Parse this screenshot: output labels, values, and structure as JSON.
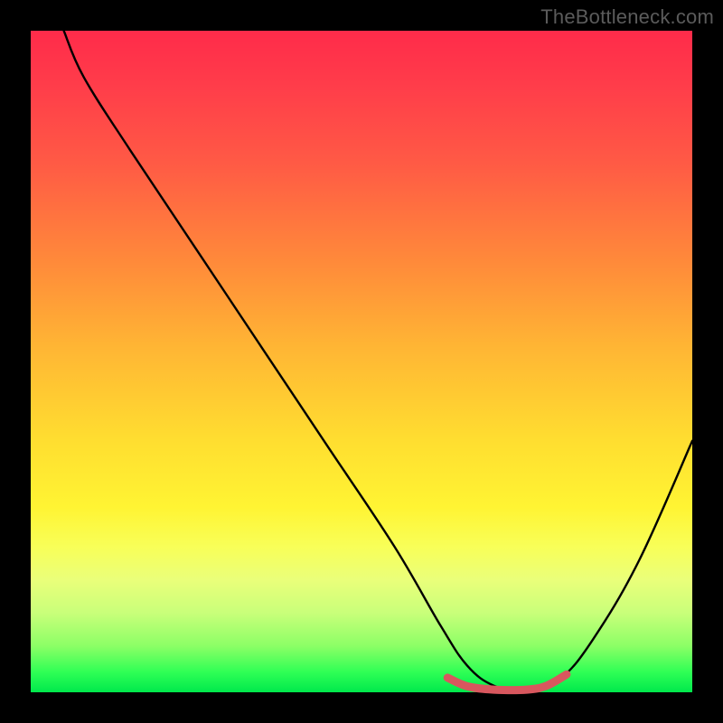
{
  "watermark": "TheBottleneck.com",
  "chart_data": {
    "type": "line",
    "title": "",
    "xlabel": "",
    "ylabel": "",
    "xlim": [
      0,
      100
    ],
    "ylim": [
      0,
      100
    ],
    "grid": false,
    "series": [
      {
        "name": "bottleneck-curve",
        "color": "#000000",
        "x": [
          5,
          8,
          15,
          25,
          35,
          45,
          55,
          62,
          66,
          70,
          75,
          80,
          85,
          92,
          100
        ],
        "y": [
          100,
          93,
          82,
          67,
          52,
          37,
          22,
          10,
          4,
          1,
          0,
          2,
          8,
          20,
          38
        ]
      },
      {
        "name": "optimal-band",
        "color": "#d8575e",
        "x": [
          63,
          66,
          70,
          75,
          78,
          81
        ],
        "y": [
          2.2,
          0.9,
          0.4,
          0.4,
          1.0,
          2.7
        ]
      }
    ],
    "annotations": []
  },
  "icons": {}
}
